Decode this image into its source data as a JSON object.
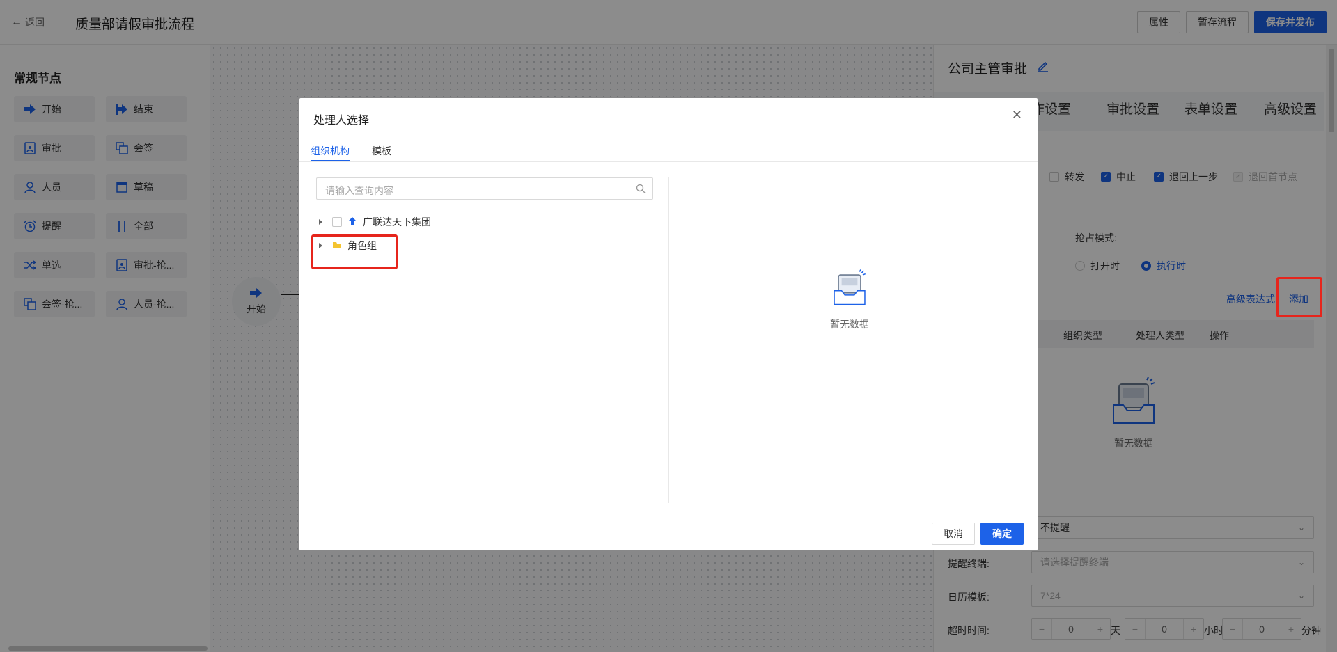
{
  "topbar": {
    "back_label": "返回",
    "title": "质量部请假审批流程",
    "buttons": [
      "属性",
      "暂存流程",
      "保存并发布"
    ]
  },
  "leftpanel": {
    "title": "常规节点",
    "nodes": [
      {
        "label": "开始",
        "icon": "arrow-right-icon"
      },
      {
        "label": "结束",
        "icon": "arrow-right-icon"
      },
      {
        "label": "审批",
        "icon": "document-person-icon"
      },
      {
        "label": "会签",
        "icon": "layers-icon"
      },
      {
        "label": "人员",
        "icon": "user-icon"
      },
      {
        "label": "草稿",
        "icon": "draft-icon"
      },
      {
        "label": "提醒",
        "icon": "alarm-clock-icon"
      },
      {
        "label": "全部",
        "icon": "parallel-icon"
      },
      {
        "label": "单选",
        "icon": "shuffle-icon"
      },
      {
        "label": "审批-抢...",
        "icon": "document-person-icon"
      },
      {
        "label": "会签-抢...",
        "icon": "layers-icon"
      },
      {
        "label": "人员-抢...",
        "icon": "user-icon"
      }
    ]
  },
  "canvas": {
    "start_node_label": "开始"
  },
  "rightpanel": {
    "title": "公司主管审批",
    "tabs": [
      "作设置",
      "审批设置",
      "表单设置",
      "高级设置"
    ],
    "checkboxes": [
      {
        "label": "转发",
        "state": "unchecked"
      },
      {
        "label": "中止",
        "state": "checked"
      },
      {
        "label": "退回上一步",
        "state": "checked"
      },
      {
        "label": "退回首节点",
        "state": "disabled-checked"
      }
    ],
    "grab_mode_label": "抢占模式:",
    "radios": [
      {
        "label": "打开时",
        "selected": false
      },
      {
        "label": "执行时",
        "selected": true
      }
    ],
    "advanced_expr_link": "高级表达式",
    "add_link": "添加",
    "table_headers": [
      "组织类型",
      "处理人类型",
      "操作"
    ],
    "empty_text": "暂无数据",
    "remind_select_value": "不提醒",
    "remind_terminal_label": "提醒终端:",
    "remind_terminal_placeholder": "请选择提醒终端",
    "calendar_label": "日历模板:",
    "calendar_value": "7*24",
    "timeout_label": "超时时间:",
    "timeout": [
      {
        "value": "0",
        "unit": "天"
      },
      {
        "value": "0",
        "unit": "小时"
      },
      {
        "value": "0",
        "unit": "分钟"
      }
    ],
    "minus": "−",
    "plus": "+"
  },
  "modal": {
    "title": "处理人选择",
    "tabs": [
      "组织机构",
      "模板"
    ],
    "active_tab": "组织机构",
    "search_placeholder": "请输入查询内容",
    "tree": [
      {
        "label": "广联达天下集团",
        "icon": "org-icon"
      },
      {
        "label": "角色组",
        "icon": "folder-icon"
      }
    ],
    "empty_text": "暂无数据",
    "cancel_label": "取消",
    "ok_label": "确定"
  },
  "colors": {
    "primary": "#1d62e8",
    "annotation_red": "#e6251c",
    "folder_yellow": "#f4c430"
  }
}
